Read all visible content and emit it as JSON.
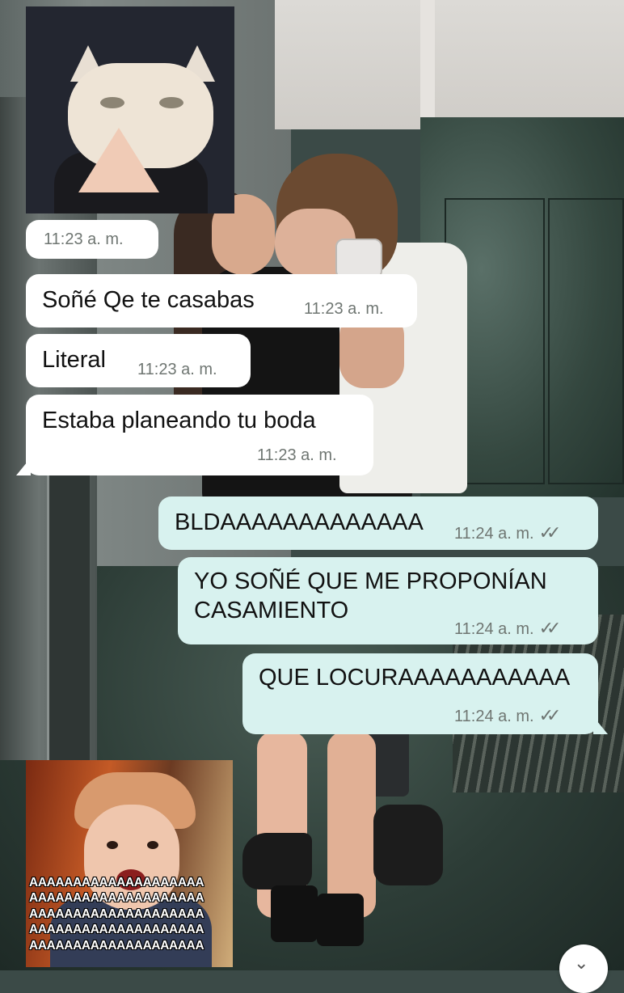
{
  "messages": [
    {
      "kind": "sticker",
      "direction": "incoming",
      "sticker": "praying-cat-sticker",
      "time": "11:23 a. m."
    },
    {
      "kind": "text",
      "direction": "incoming",
      "text": "Soñé Qe te casabas",
      "time": "11:23 a. m."
    },
    {
      "kind": "text",
      "direction": "incoming",
      "text": "Literal",
      "time": "11:23 a. m."
    },
    {
      "kind": "text",
      "direction": "incoming",
      "text": "Estaba planeando tu boda",
      "time": "11:23 a. m."
    },
    {
      "kind": "text",
      "direction": "outgoing",
      "text": "BLDAAAAAAAAAAAAA",
      "time": "11:24 a. m.",
      "status": "read-double-check"
    },
    {
      "kind": "text",
      "direction": "outgoing",
      "text": "YO SOÑÉ QUE ME PROPONÍAN\nCASAMIENTO",
      "time": "11:24 a. m.",
      "status": "read-double-check"
    },
    {
      "kind": "text",
      "direction": "outgoing",
      "text": "QUE LOCURAAAAAAAAAAA",
      "time": "11:24 a. m.",
      "status": "read-double-check"
    },
    {
      "kind": "sticker",
      "direction": "outgoing",
      "sticker": "screaming-kid-sticker",
      "caption": "AAAAAAAAAAAAAAAAAAAA\nAAAAAAAAAAAAAAAAAAAA\nAAAAAAAAAAAAAAAAAAAA\nAAAAAAAAAAAAAAAAAAAA\nAAAAAAAAAAAAAAAAAAAA"
    }
  ],
  "icons": {
    "read_receipt": "double-check-icon",
    "read_receipt_glyph": "✓✓",
    "scroll_down": "chevron-down-icon",
    "scroll_down_glyph": "⌄"
  },
  "colors": {
    "incoming_bubble": "#ffffff",
    "outgoing_bubble": "#d8f2ef",
    "timestamp": "#6f7672"
  }
}
